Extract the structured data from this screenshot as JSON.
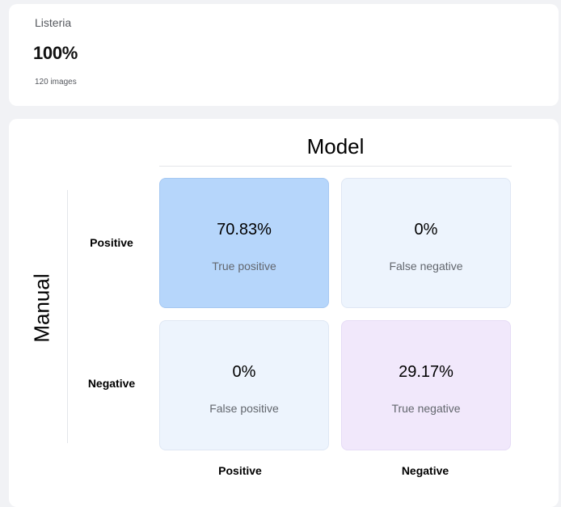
{
  "summary": {
    "label": "Listeria",
    "value": "100%",
    "count": "120 images"
  },
  "matrix": {
    "column_title": "Model",
    "row_title": "Manual",
    "row_labels": [
      "Positive",
      "Negative"
    ],
    "column_labels": [
      "Positive",
      "Negative"
    ],
    "cells": {
      "true_positive": {
        "value": "70.83%",
        "caption": "True positive"
      },
      "false_negative": {
        "value": "0%",
        "caption": "False negative"
      },
      "false_positive": {
        "value": "0%",
        "caption": "False positive"
      },
      "true_negative": {
        "value": "29.17%",
        "caption": "True negative"
      }
    },
    "colors": {
      "true_positive": "#b6d6fb",
      "false_cells": "#edf4fd",
      "true_negative": "#f1e8fb"
    }
  }
}
